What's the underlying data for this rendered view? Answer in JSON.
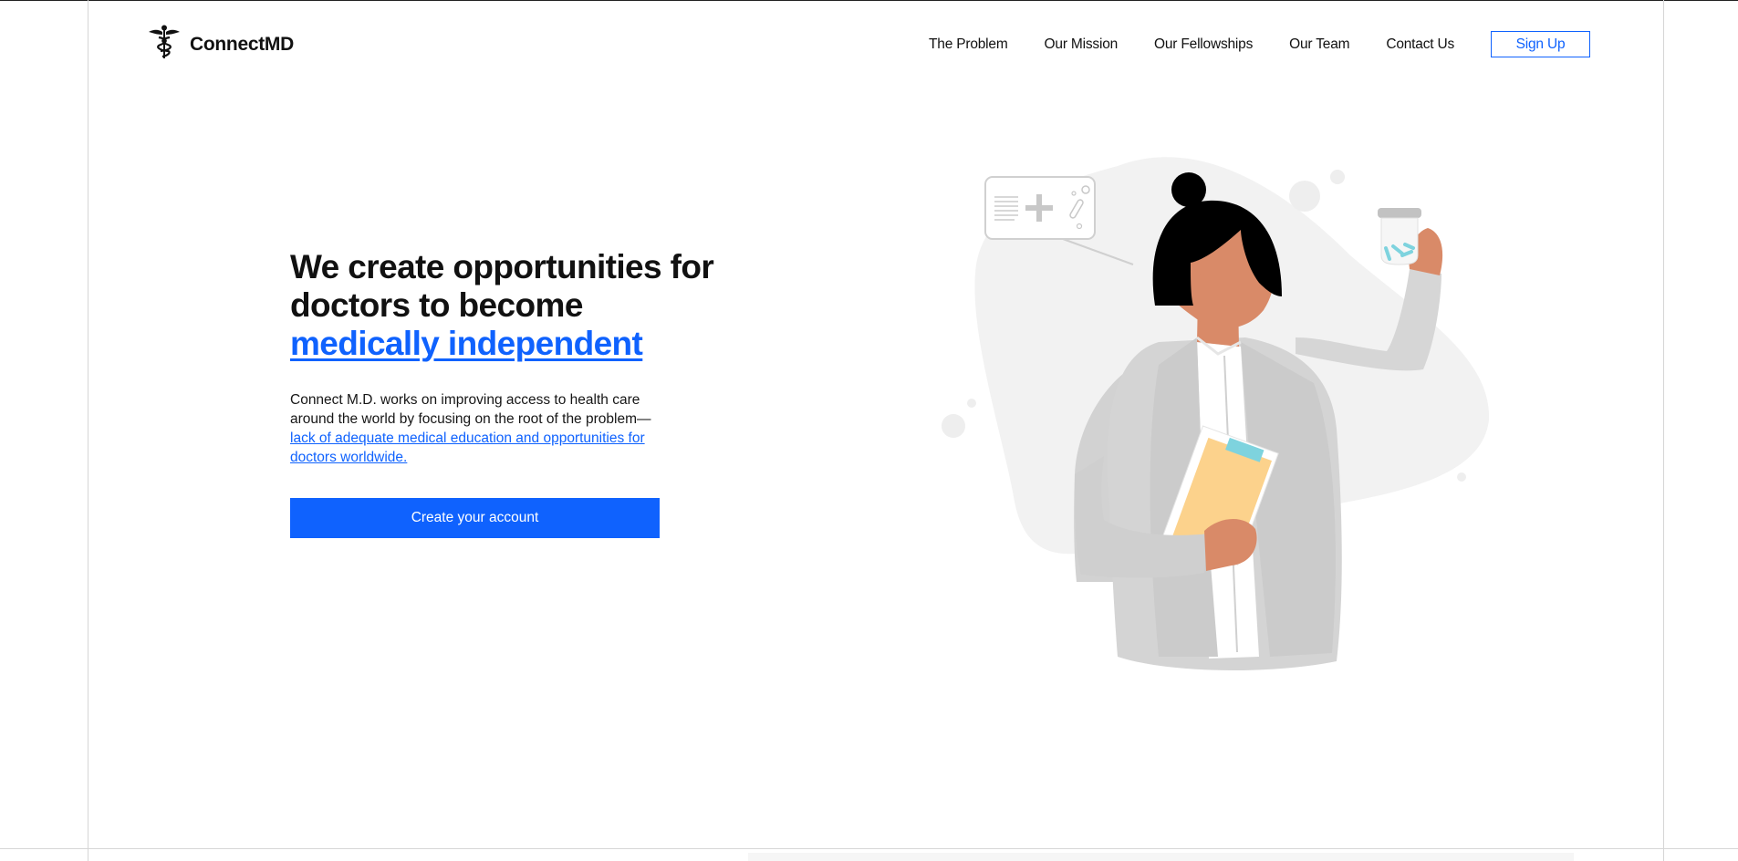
{
  "brand": {
    "name": "ConnectMD",
    "logo_icon": "caduceus-icon"
  },
  "nav": {
    "items": [
      "The Problem",
      "Our Mission",
      "Our Fellowships",
      "Our Team",
      "Contact Us"
    ],
    "signup_label": "Sign Up"
  },
  "hero": {
    "title_line1": "We create opportunities for",
    "title_line2": "doctors to become",
    "title_accent": "medically independent",
    "body_text": "Connect M.D. works on improving access to health care around the world by focusing on the root of the problem—",
    "body_link": "lack of adequate medical education and opportunities for doctors worldwide.",
    "cta_label": "Create your account"
  },
  "colors": {
    "accent": "#0f62fe",
    "text": "#111111",
    "blob": "#f2f2f2",
    "coat": "#d4d4d4",
    "skin": "#d98a68",
    "folder": "#fcd28c",
    "pills": "#7ed3de"
  }
}
